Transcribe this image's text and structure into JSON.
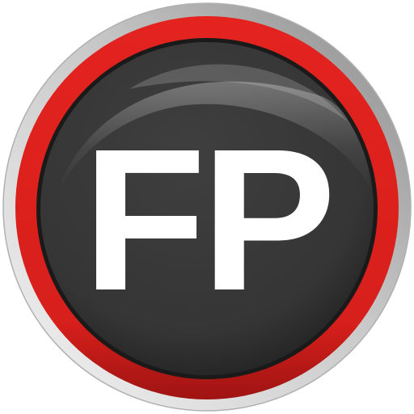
{
  "logo": {
    "text": "FP",
    "colors": {
      "outer_ring_light": "#f4f4f4",
      "outer_ring_dark": "#8a8a8a",
      "red_ring": "#e4231f",
      "red_ring_dark": "#9e1412",
      "face": "#353535",
      "face_dark": "#1c1c1c",
      "text": "#ffffff"
    }
  }
}
